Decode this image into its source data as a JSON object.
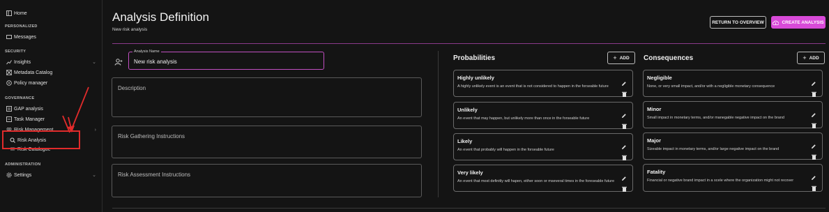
{
  "sidebar": {
    "home": "Home",
    "personalized_section": "PERSONALIZED",
    "messages": "Messages",
    "security_section": "SECURITY",
    "insights": "Insights",
    "metadata_catalog": "Metadata Catalog",
    "policy_manager": "Policy manager",
    "governance_section": "GOVERNANCE",
    "gap_analysis": "GAP analysis",
    "task_manager": "Task Manager",
    "risk_management": "Risk Management",
    "risk_analysis": "Risk Analysis",
    "risk_catalogue": "Risk Catalogue",
    "administration_section": "ADMINISTRATION",
    "settings": "Settings"
  },
  "header": {
    "title": "Analysis Definition",
    "subtitle": "New risk analysis",
    "return_button": "RETURN TO OVERVIEW",
    "create_button": "CREATE ANALYSIS"
  },
  "form": {
    "name_label": "Analysis Name",
    "name_value": "New risk analysis",
    "description_label": "Description",
    "gathering_label": "Risk Gathering Instructions",
    "assessment_label": "Risk Assessment Instructions"
  },
  "probabilities": {
    "title": "Probabilities",
    "add_label": "ADD",
    "items": [
      {
        "title": "Highly unlikely",
        "desc": "A highly unlikely event is an event that is not considered to happen in the forseable future"
      },
      {
        "title": "Unlikely",
        "desc": "An event that may happen, but unlikely more than once in the forseable future"
      },
      {
        "title": "Likely",
        "desc": "An event that probably will happen in the forseable future"
      },
      {
        "title": "Very likely",
        "desc": "An event that most definitly will hapen, either soon or mseveral times in the foreseable future"
      }
    ]
  },
  "consequences": {
    "title": "Consequences",
    "add_label": "ADD",
    "items": [
      {
        "title": "Negligible",
        "desc": "None, or very small impact, and/or with a negligible monetary consequence"
      },
      {
        "title": "Minor",
        "desc": "Small impact in monetary terms, and/or manegable negative impact on the brand"
      },
      {
        "title": "Major",
        "desc": "Sizeable impact in monetary terms, and/or large negative impact on the brand"
      },
      {
        "title": "Fatality",
        "desc": "Financial or negative brand impact in a scele where the organization might not recover"
      }
    ]
  },
  "colors": {
    "accent": "#d84ad8",
    "highlight_box": "#e12b2b",
    "background": "#141414"
  }
}
